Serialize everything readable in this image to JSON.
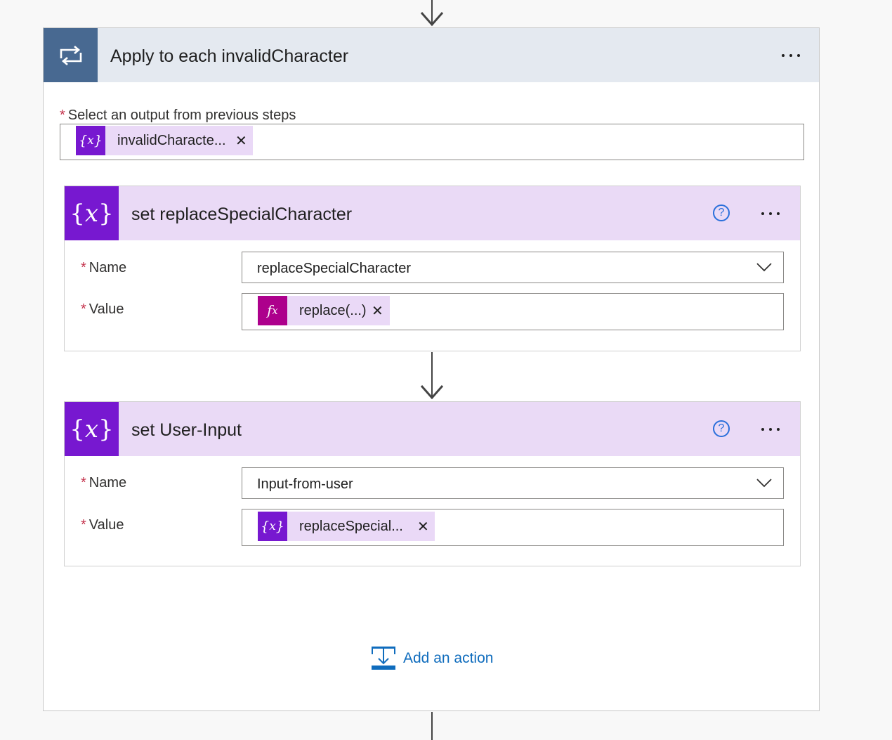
{
  "loop": {
    "title": "Apply to each invalidCharacter",
    "output_label": "Select an output from previous steps",
    "output_token": {
      "text": "invalidCharacte...",
      "icon": "variable-icon"
    }
  },
  "actions": [
    {
      "title": "set replaceSpecialCharacter",
      "name_label": "Name",
      "name_value": "replaceSpecialCharacter",
      "value_label": "Value",
      "value_token": {
        "text": "replace(...)",
        "icon": "expression-icon"
      }
    },
    {
      "title": "set User-Input",
      "name_label": "Name",
      "name_value": "Input-from-user",
      "value_label": "Value",
      "value_token": {
        "text": "replaceSpecial...",
        "icon": "variable-icon"
      }
    }
  ],
  "add_action_label": "Add an action",
  "colors": {
    "loop_accent": "#486991",
    "variable_accent": "#7718d0",
    "expression_accent": "#ad008c",
    "link": "#0f6cbd",
    "required": "#c4314b"
  }
}
